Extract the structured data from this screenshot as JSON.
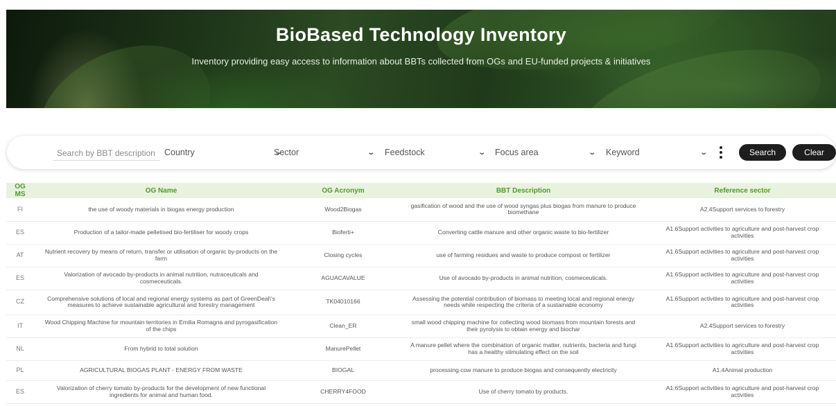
{
  "hero": {
    "title": "BioBased Technology Inventory",
    "subtitle": "Inventory providing easy access to information about BBTs collected from OGs and EU-funded projects & initiatives"
  },
  "search": {
    "placeholder": "Search by BBT description",
    "country_label": "Country",
    "sector_label": "Sector",
    "feedstock_label": "Feedstock",
    "focus_area_label": "Focus area",
    "keyword_label": "Keyword",
    "search_button": "Search",
    "clear_button": "Clear",
    "chevron_icon": "chevron-down-icon",
    "more_icon": "more-vertical-icon"
  },
  "table": {
    "columns": [
      "OG MS",
      "OG Name",
      "OG Acronym",
      "BBT Description",
      "Reference sector"
    ],
    "rows": [
      {
        "ms": "FI",
        "name": "the use of woody materials in biogas energy production",
        "acronym": "Wood2Biogas",
        "description": "gasification of wood and the use of wood syngas plus biogas from manure to produce biomethane",
        "sector": "A2.4Support services to forestry"
      },
      {
        "ms": "ES",
        "name": "Production of a tailor-made pelletised bio-fertiliser for woody crops",
        "acronym": "Bioferti+",
        "description": "Converting cattle manure and other organic waste to bio-fertilizer",
        "sector": "A1.6Support activities to agriculture and post-harvest crop activities"
      },
      {
        "ms": "AT",
        "name": "Nutrient recovery by means of return, transfer or utilisation of organic by-products on the farm",
        "acronym": "Closing cycles",
        "description": "use of farming residues and waste to produce compost or fertilizer",
        "sector": "A1.6Support activities to agriculture and post-harvest crop activities"
      },
      {
        "ms": "ES",
        "name": "Valorization of avocado by-products in animal nutrition, nutraceuticals and cosmeceuticals.",
        "acronym": "AGUACAVALUE",
        "description": "Use of avocado by-products in animal nutrition, cosmeceuticals.",
        "sector": "A1.6Support activities to agriculture and post-harvest crop activities"
      },
      {
        "ms": "CZ",
        "name": "Comprehensive solutions of local and regional energy systems as part of GreenDeal\\'s measures to achieve sustainable agricultural and forestry management",
        "acronym": "TK04010166",
        "description": "Assessing the potential contribution of biomass to meeting local and regional energy needs while respecting the criteria of a sustainable economy",
        "sector": "A1.6Support activities to agriculture and post-harvest crop activities"
      },
      {
        "ms": "IT",
        "name": "Wood Chipping Machine for mountain territories in Emilia Romagna and pyrogasification of the chips",
        "acronym": "Clean_ER",
        "description": "small wood chipping machine for collecting wood biomass from mountain forests and their pyrolysis to obtain energy and biochar",
        "sector": "A2.4Support services to forestry"
      },
      {
        "ms": "NL",
        "name": "From hybrid to total solution",
        "acronym": "ManurePellet",
        "description": "A manure pellet where the combination of organic matter, nutrients, bacteria and fungi has a healthy stimulating effect on the soil",
        "sector": "A1.6Support activities to agriculture and post-harvest crop activities"
      },
      {
        "ms": "PL",
        "name": "AGRICULTURAL BIOGAS PLANT - ENERGY FROM WASTE",
        "acronym": "BIOGAL",
        "description": "processing cow manure to produce biogas and consequently electricity",
        "sector": "A1.4Animal production"
      },
      {
        "ms": "ES",
        "name": "Valorization of cherry tomato by-products for the development of new functional ingredients for animal and human food.",
        "acronym": "CHERRY4FOOD",
        "description": "Use of cherry tomato by products.",
        "sector": "A1.6Support activities to agriculture and post-harvest crop activities"
      }
    ]
  },
  "colors": {
    "header_text": "#4f9a2b",
    "header_bg": "#e8f2df",
    "button_bg": "#1e1e1e"
  }
}
